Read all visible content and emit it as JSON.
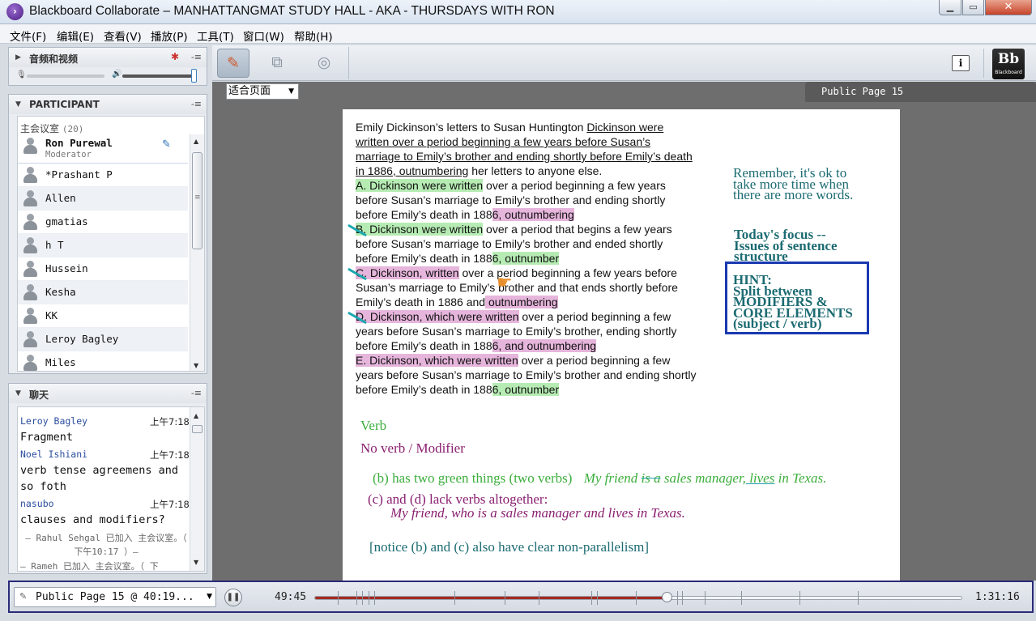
{
  "window": {
    "title": "Blackboard Collaborate – MANHATTANGMAT STUDY HALL - AKA - THURSDAYS WITH RON",
    "minimize": "▁",
    "maximize": "▭",
    "close": "✕"
  },
  "menu": [
    "文件(F)",
    "编辑(E)",
    "查看(V)",
    "播放(P)",
    "工具(T)",
    "窗口(W)",
    "帮助(H)"
  ],
  "av_panel": {
    "title": "音频和视频",
    "mic_level": 0.0,
    "speaker_level": 1.0
  },
  "participants": {
    "title": "PARTICIPANT",
    "room_name": "主会议室",
    "room_count": "(20)",
    "list": [
      {
        "name": "Ron Purewal",
        "role": "Moderator"
      },
      {
        "name": "*Prashant P"
      },
      {
        "name": "Allen"
      },
      {
        "name": "gmatias"
      },
      {
        "name": "h T"
      },
      {
        "name": "Hussein"
      },
      {
        "name": "Kesha"
      },
      {
        "name": "KK"
      },
      {
        "name": "Leroy Bagley"
      },
      {
        "name": "Miles"
      }
    ]
  },
  "chat": {
    "title": "聊天",
    "messages": [
      {
        "sender": "Leroy Bagley",
        "time": "上午7:18",
        "text": "Fragment"
      },
      {
        "sender": "Noel Ishiani",
        "time": "上午7:18",
        "text": "verb tense agreemens and so foth"
      },
      {
        "sender": "nasubo",
        "time": "上午7:18",
        "text": "clauses and modifiers?"
      }
    ],
    "system": [
      "– Rahul Sehgal 已加入 主会议室。（ 下午10:17 ）–",
      "– Rameh 已加入 主会议室。（ 下"
    ]
  },
  "toolbar": {
    "info": "i",
    "logo": "Bb",
    "logo_sub": "Blackboard"
  },
  "content": {
    "zoom_label": "适合页面",
    "page_tab": "Public Page 15",
    "question": {
      "l1a": "Emily Dickinson’s letters to Susan Huntington ",
      "l1b": "Dickinson were",
      "l2": "written over a period beginning a few years before Susan’s",
      "l3": "marriage to Emily’s brother and ending shortly before Emily’s death",
      "l4a": "in 1886, outnumbering",
      "l4b": " her letters to anyone else.",
      "a1g": "A. Dickinson were written",
      "a1r": " over a period beginning a few years",
      "a2": "before Susan’s marriage to Emily’s brother and ending shortly",
      "a3a": "before Emily’s death in 188",
      "a3p": "6, outnumbering",
      "b1g": "B. Dickinson were written",
      "b1r": " over a period that begins a few years",
      "b2": "before Susan’s marriage to Emily’s brother and ended shortly",
      "b3a": "before Emily’s death in 188",
      "b3g": "6, outnumber",
      "c1p": "C. Dickinson, written",
      "c1r": " over a period beginning a few years before",
      "c2": "Susan’s marriage to Emily’s brother and that ends shortly before",
      "c3a": "Emily’s death in 1886 and",
      "c3p": " outnumbering",
      "d1p": "D. Dickinson, which were written",
      "d1r": " over a period beginning a few",
      "d2": "years before Susan’s marriage to Emily’s brother, ending shortly",
      "d3a": "before Emily’s death in 188",
      "d3p": "6, and outnumbering",
      "e1p": "E. Dickinson, which were written",
      "e1r": " over a period beginning a few",
      "e2": "years before Susan’s marriage to Emily’s brother and ending shortly",
      "e3a": "before Emily’s death in 188",
      "e3g": "6, outnumber"
    },
    "notes": {
      "remember": [
        "Remember, it's ok to",
        "take more time when",
        "there are more words."
      ],
      "focus": [
        "Today's focus --",
        "Issues of sentence",
        "structure"
      ],
      "hint": [
        "HINT:",
        "Split between",
        "MODIFIERS &",
        "CORE ELEMENTS",
        "(subject / verb)"
      ],
      "verb": "Verb",
      "no_verb": "No verb / Modifier",
      "b_line": "(b) has two green things (two verbs)",
      "b_ex1": "My friend ",
      "b_ex_strike": "is a",
      "b_ex2": " sales manager,",
      "b_ex_ul": " lives",
      "b_ex3": " in Texas.",
      "c_line": "(c) and (d) lack verbs altogether:",
      "c_ex": "My friend, who is a sales manager and lives in Texas.",
      "notice": "[notice (b) and (c) also have clear non-parallelism]"
    }
  },
  "playback": {
    "page_label": "Public Page 15 @ 40:19...",
    "elapsed": "49:45",
    "total": "1:31:16",
    "progress": 0.545
  },
  "colors": {
    "accent": "#a52a22",
    "highlight_green": "#b6ecb3",
    "highlight_pink": "#e6b5dc",
    "note_teal": "#1c6b72",
    "hint_border": "#1a3ab0"
  }
}
